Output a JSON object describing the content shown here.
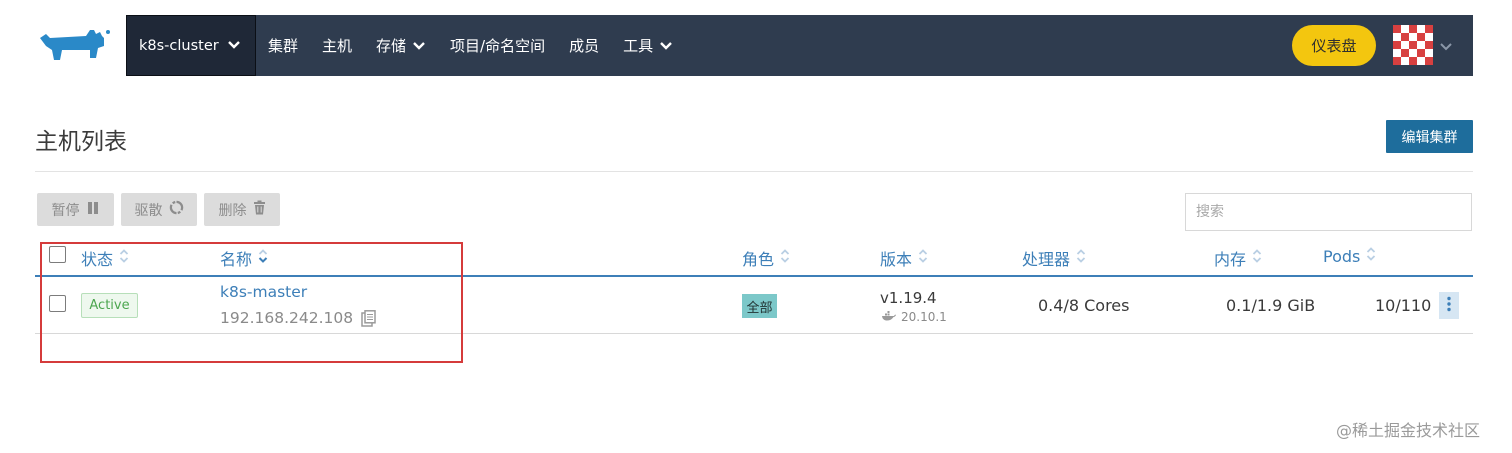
{
  "header": {
    "cluster_name": "k8s-cluster",
    "nav": [
      {
        "label": "集群",
        "dropdown": false
      },
      {
        "label": "主机",
        "dropdown": false
      },
      {
        "label": "存储",
        "dropdown": true
      },
      {
        "label": "项目/命名空间",
        "dropdown": false
      },
      {
        "label": "成员",
        "dropdown": false
      },
      {
        "label": "工具",
        "dropdown": true
      }
    ],
    "dashboard_label": "仪表盘",
    "logo_icon": "rancher-logo-icon",
    "colors": {
      "navbar": "#2f3c4f",
      "cluster_bg": "#1f2837",
      "dashboard": "#f3c60f"
    }
  },
  "page": {
    "title": "主机列表",
    "edit_cluster_label": "编辑集群"
  },
  "actions": {
    "pause_label": "暂停",
    "drain_label": "驱散",
    "delete_label": "删除",
    "search_placeholder": "搜索"
  },
  "table": {
    "columns": {
      "state": "状态",
      "name": "名称",
      "role": "角色",
      "version": "版本",
      "cpu": "处理器",
      "memory": "内存",
      "pods": "Pods"
    },
    "rows": [
      {
        "state": "Active",
        "name": "k8s-master",
        "ip": "192.168.242.108",
        "role": "全部",
        "k8s_version": "v1.19.4",
        "docker_version": "20.10.1",
        "cpu": "0.4/8 Cores",
        "memory": "0.1/1.9 GiB",
        "pods": "10/110"
      }
    ]
  },
  "watermark": "@稀土掘金技术社区",
  "accent_colors": {
    "link": "#3d7fb8",
    "primary_button": "#1e6d9c",
    "active_green": "#4ca64f",
    "annotation_red": "#d53b3b"
  }
}
